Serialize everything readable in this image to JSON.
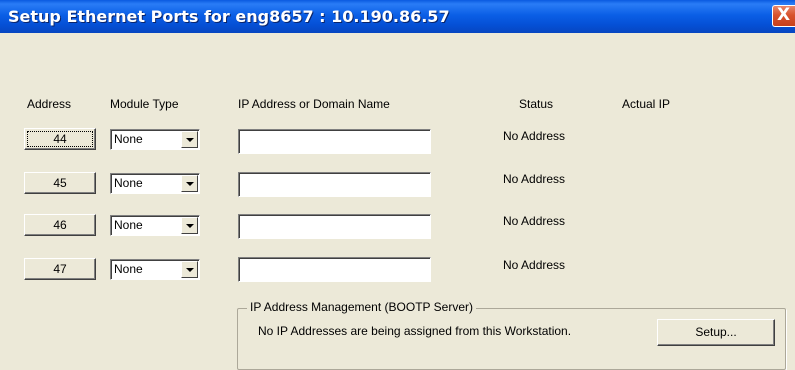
{
  "window": {
    "title": "Setup Ethernet Ports for eng8657 : 10.190.86.57",
    "close_glyph": "X"
  },
  "headers": {
    "address": "Address",
    "module_type": "Module Type",
    "ip_or_domain": "IP Address or Domain Name",
    "status": "Status",
    "actual_ip": "Actual IP"
  },
  "ports": [
    {
      "address": "44",
      "module_type": "None",
      "ip": "",
      "status": "No Address",
      "actual_ip": ""
    },
    {
      "address": "45",
      "module_type": "None",
      "ip": "",
      "status": "No Address",
      "actual_ip": ""
    },
    {
      "address": "46",
      "module_type": "None",
      "ip": "",
      "status": "No Address",
      "actual_ip": ""
    },
    {
      "address": "47",
      "module_type": "None",
      "ip": "",
      "status": "No Address",
      "actual_ip": ""
    }
  ],
  "ip_management": {
    "group_label": "IP Address Management (BOOTP Server)",
    "message": "No IP Addresses are being assigned from this Workstation.",
    "setup_label": "Setup..."
  }
}
